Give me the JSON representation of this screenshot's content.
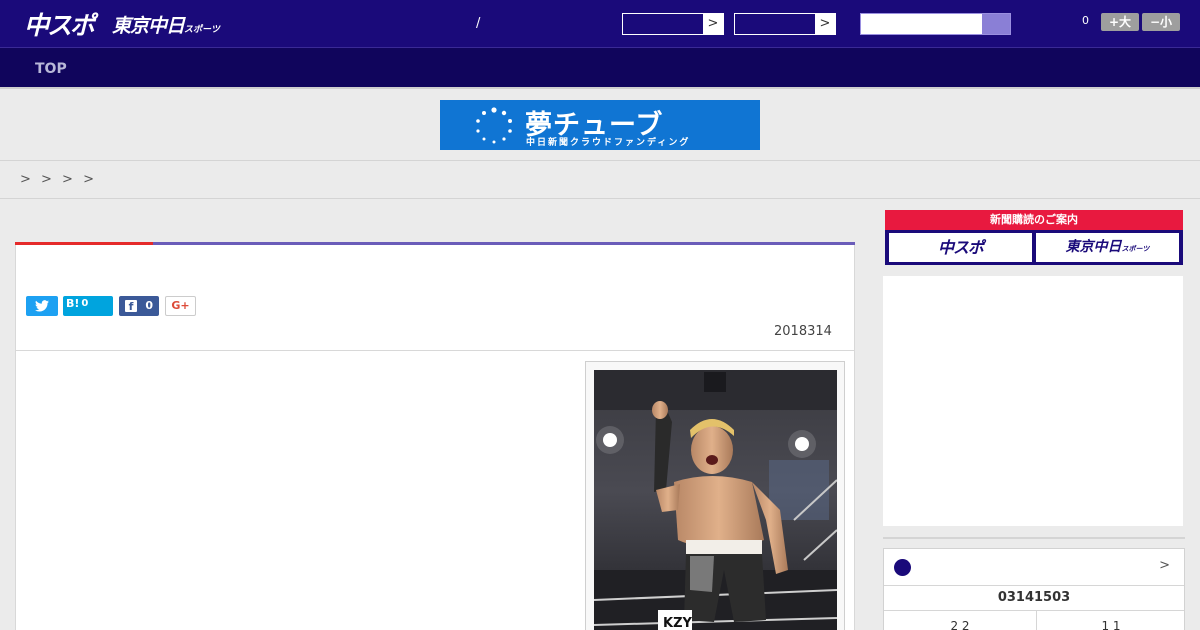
{
  "header": {
    "logo_main": "中スポ",
    "logo_sub": "東京中日",
    "logo_sub_small": "スポーツ",
    "separator": "/",
    "select_arrow": ">",
    "count": "0",
    "font_bigger": "+大",
    "font_smaller": "−小"
  },
  "nav": {
    "items": [
      "TOP"
    ]
  },
  "banner": {
    "title": "夢チューブ",
    "subtitle": "中日新聞クラウドファンディング"
  },
  "breadcrumb": {
    "text": "> > > >"
  },
  "article": {
    "share": {
      "twitter_icon": "twitter-icon",
      "hatena_label": "B!",
      "hatena_count": "0",
      "facebook_icon": "f",
      "facebook_count": "0",
      "gplus_label": "G+"
    },
    "date": "2018314"
  },
  "sidebar": {
    "subscribe_title": "新聞購読のご案内",
    "subscribe_left": "中スポ",
    "subscribe_right": "東京中日",
    "subscribe_right_small": "スポーツ",
    "score": {
      "more": ">",
      "date": "03141503",
      "left_score": "2 2",
      "right_score": "1 1"
    }
  },
  "colors": {
    "header_bg": "#1a0a7a",
    "nav_bg": "#10055c",
    "accent_red": "#e52a2a",
    "accent_purple": "#6a5cb9",
    "banner_blue": "#1075d3"
  }
}
